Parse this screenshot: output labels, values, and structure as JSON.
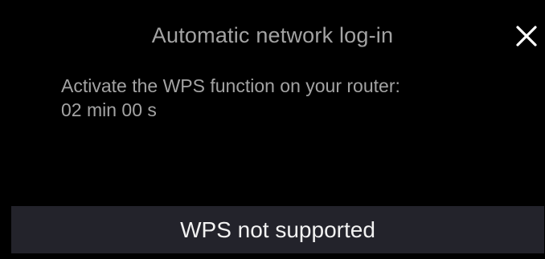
{
  "dialog": {
    "title": "Automatic network log-in",
    "close_icon": "close-icon",
    "message_line": "Activate the WPS function on your router:",
    "countdown": "02 min 00 s"
  },
  "actions": {
    "wps_not_supported_label": "WPS not supported"
  },
  "colors": {
    "background": "#000000",
    "secondary_text": "#a3a3a3",
    "button_background": "#23232b",
    "button_text": "#f2f2f2",
    "icon": "#ffffff"
  }
}
